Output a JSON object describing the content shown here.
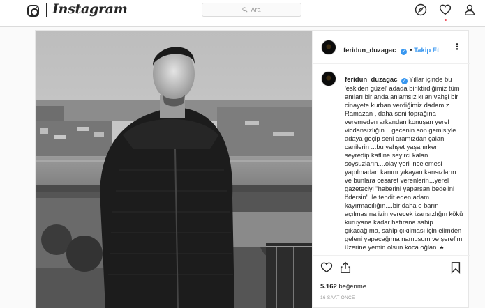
{
  "topbar": {
    "brand": "Instagram",
    "search_placeholder": "Ara",
    "icons": [
      "instagram-glyph-icon",
      "compass-icon",
      "heart-icon",
      "profile-icon"
    ]
  },
  "post": {
    "username": "feridun_duzagac",
    "follow_label": "Takip Et",
    "caption": "Yıllar içinde bu 'eskiden güzel' adada biriktirdiğimiz tüm anıları bir anda anlamsız kılan vahşi bir cinayete kurban verdiğimiz dadamız Ramazan , daha seni toprağına veremeden arkandan konuşan yerel vicdansızlığın ...gecenin son gemisiyle adaya geçip seni aramızdan çalan canilerin ...bu vahşet yaşanırken seyredip katline seyirci kalan soysuzların....olay yeri incelemesi yapılmadan kanını yıkayan kansızların ve bunlara cesaret verenlerin...yerel gazeteciyi \"haberini yaparsan bedelini ödersin\" ile tehdit eden adam kayırmacılığın....bir daha o barın açılmasına izin verecek izansızlığın kökü kuruyana kadar hatırana sahip çıkacağıma, sahip çıkılması için elimden geleni yapacağıma namusum ve şerefim üzerine yemin olsun koca oğlan..♠",
    "likes_count": "5.162",
    "likes_label": "beğenme",
    "time_ago": "16 SAAT ÖNCE",
    "photo_description": "black-and-white photo of a man on a terrace above a city skyline",
    "colors": {
      "link": "#3897f0",
      "text": "#262626",
      "muted": "#999999",
      "border": "#dbdbdb"
    }
  }
}
